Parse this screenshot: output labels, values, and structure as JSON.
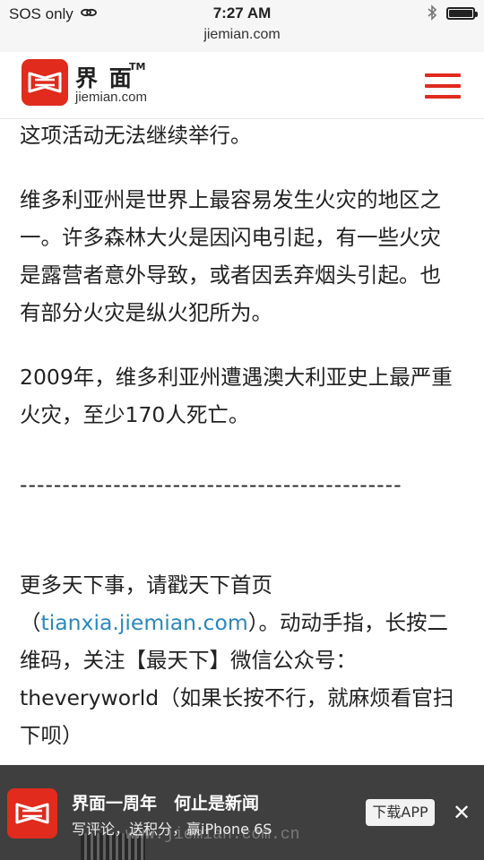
{
  "status_bar": {
    "carrier": "SOS only",
    "time": "7:27 AM",
    "url": "jiemian.com"
  },
  "header": {
    "logo_name": "界 面",
    "logo_tm": "TM",
    "logo_domain": "jiemian.com",
    "brand_color": "#e02b1d"
  },
  "article": {
    "paragraphs": [
      "这项活动无法继续举行。",
      "维多利亚州是世界上最容易发生火灾的地区之一。许多森林大火是因闪电引起，有一些火灾是露营者意外导致，或者因丢弃烟头引起。也有部分火灾是纵火犯所为。",
      "2009年，维多利亚州遭遇澳大利亚史上最严重火灾，至少170人死亡。",
      "---------------------------------------------",
      "更多天下事，请戳天下首页"
    ],
    "link_open": "（",
    "link_text": "tianxia.jiemian.com",
    "after_link": "）。动动手指，长按二维码，关注【最天下】微信公众号：theveryworld（如果长按不行，就麻烦看官扫下呗）",
    "link_color": "#2a88c0"
  },
  "banner": {
    "title": "界面一周年　何止是新闻",
    "subtitle": "写评论，送积分，赢iPhone 6S",
    "download_label": "下载APP",
    "close_glyph": "✕",
    "ghost_text": "www.jiemian.com.cn"
  }
}
